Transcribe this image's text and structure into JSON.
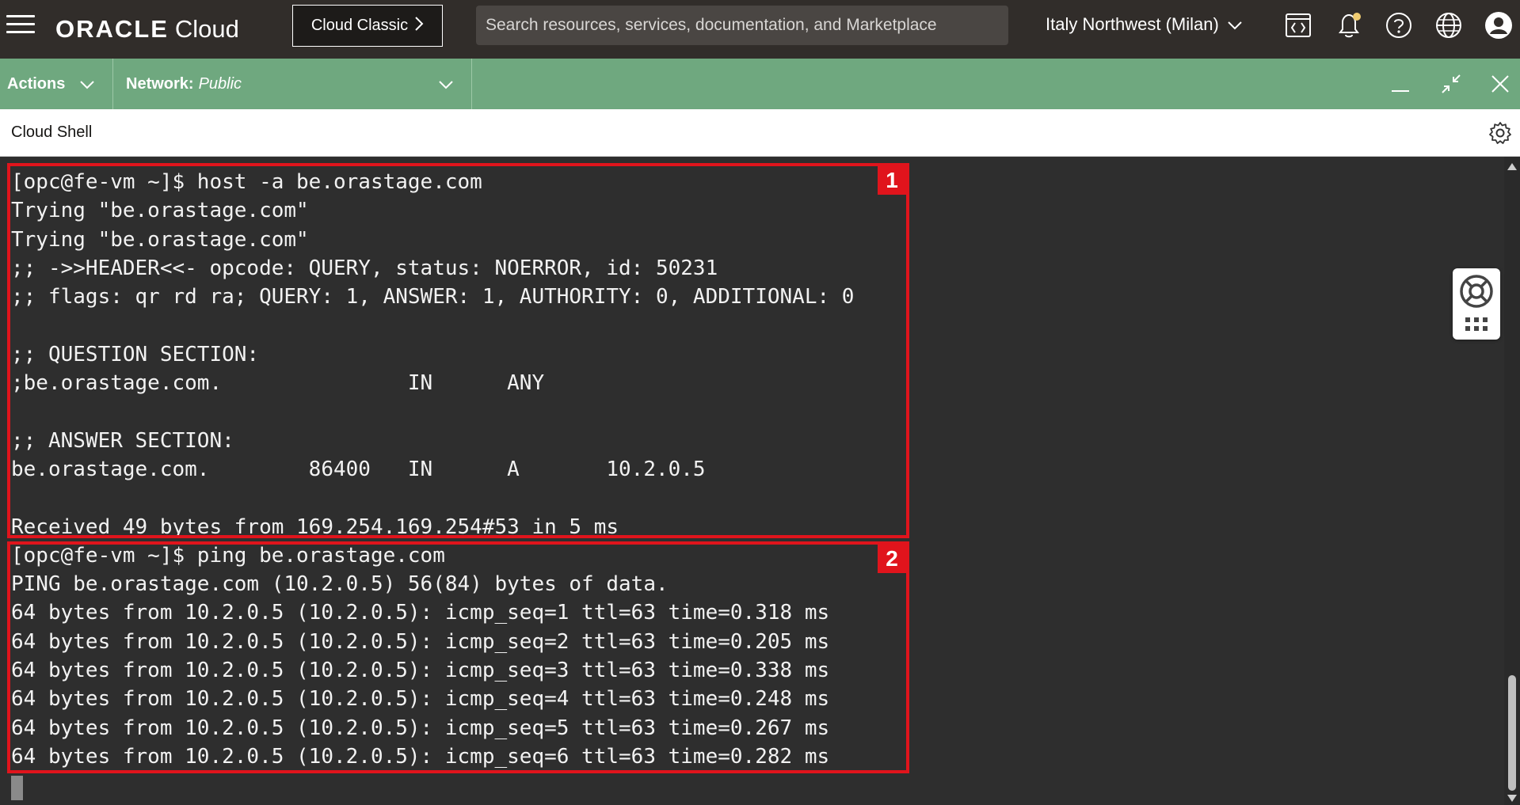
{
  "header": {
    "brand_oracle": "ORACLE",
    "brand_cloud": "Cloud",
    "classic_button": "Cloud Classic",
    "search_placeholder": "Search resources, services, documentation, and Marketplace",
    "region": "Italy Northwest (Milan)",
    "icons": [
      "menu-icon",
      "code-editor-icon",
      "notifications-icon",
      "help-icon",
      "language-icon",
      "profile-icon"
    ],
    "notification_dot_color": "#f0cc71"
  },
  "toolbar": {
    "actions_label": "Actions",
    "network_label": "Network:",
    "network_value": "Public",
    "bar_color": "#6fa87f",
    "icons": [
      "minimize-icon",
      "restore-icon",
      "close-icon"
    ]
  },
  "shell": {
    "title": "Cloud Shell",
    "settings_icon": "gear-icon"
  },
  "terminal": {
    "lines": [
      "[opc@fe-vm ~]$ host -a be.orastage.com",
      "Trying \"be.orastage.com\"",
      "Trying \"be.orastage.com\"",
      ";; ->>HEADER<<- opcode: QUERY, status: NOERROR, id: 50231",
      ";; flags: qr rd ra; QUERY: 1, ANSWER: 1, AUTHORITY: 0, ADDITIONAL: 0",
      "",
      ";; QUESTION SECTION:",
      ";be.orastage.com.               IN      ANY",
      "",
      ";; ANSWER SECTION:",
      "be.orastage.com.        86400   IN      A       10.2.0.5",
      "",
      "Received 49 bytes from 169.254.169.254#53 in 5 ms",
      "[opc@fe-vm ~]$ ping be.orastage.com",
      "PING be.orastage.com (10.2.0.5) 56(84) bytes of data.",
      "64 bytes from 10.2.0.5 (10.2.0.5): icmp_seq=1 ttl=63 time=0.318 ms",
      "64 bytes from 10.2.0.5 (10.2.0.5): icmp_seq=2 ttl=63 time=0.205 ms",
      "64 bytes from 10.2.0.5 (10.2.0.5): icmp_seq=3 ttl=63 time=0.338 ms",
      "64 bytes from 10.2.0.5 (10.2.0.5): icmp_seq=4 ttl=63 time=0.248 ms",
      "64 bytes from 10.2.0.5 (10.2.0.5): icmp_seq=5 ttl=63 time=0.267 ms",
      "64 bytes from 10.2.0.5 (10.2.0.5): icmp_seq=6 ttl=63 time=0.282 ms"
    ],
    "annotations": [
      "1",
      "2"
    ],
    "annotation_color": "#e0141c"
  },
  "help_widget": {
    "icons": [
      "lifebuoy-icon",
      "apps-grid-icon"
    ]
  }
}
